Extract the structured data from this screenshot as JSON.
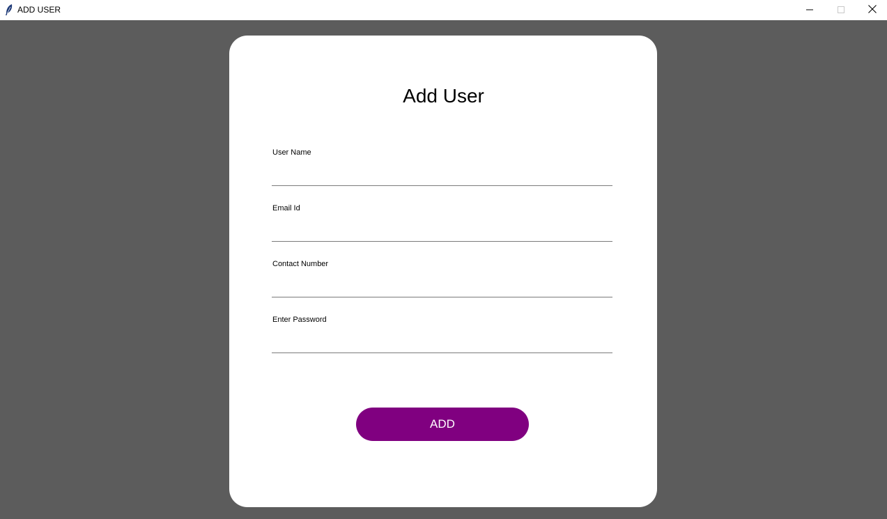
{
  "window": {
    "title": "ADD USER",
    "app_icon": "feather-icon",
    "controls": [
      "minimize-icon",
      "maximize-icon",
      "close-icon"
    ]
  },
  "form": {
    "title": "Add User",
    "fields": [
      {
        "label": "User Name",
        "value": "",
        "placeholder": ""
      },
      {
        "label": "Email Id",
        "value": "",
        "placeholder": ""
      },
      {
        "label": "Contact Number",
        "value": "",
        "placeholder": ""
      },
      {
        "label": "Enter Password",
        "value": "",
        "placeholder": ""
      }
    ],
    "submit_label": "ADD"
  },
  "colors": {
    "background": "#5c5c5c",
    "card": "#ffffff",
    "button": "#800080",
    "button_text": "#ffffff"
  }
}
